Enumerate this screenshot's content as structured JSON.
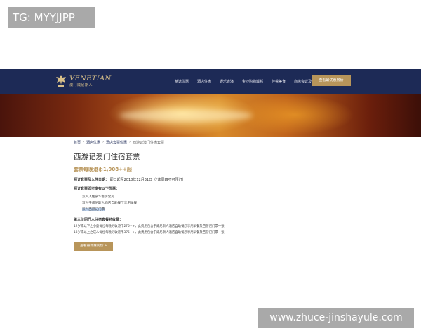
{
  "watermarks": {
    "top": "TG: MYYJJPP",
    "bottom": "www.zhuce-jinshayule.com"
  },
  "brand": {
    "name": "VENETIAN",
    "sub": "澳门威尼斯人",
    "accent": "#b8955a",
    "nav_bg": "#1d2a56"
  },
  "nav": {
    "items": [
      "精选优惠",
      "酒店住宿",
      "娱乐表演",
      "金沙购物城邦",
      "佳肴美食",
      "商务会议及婚宴"
    ],
    "cta": "查看最优惠房价"
  },
  "breadcrumb": [
    "首页",
    "酒店优惠",
    "酒店套票优惠",
    "西游记澳门住宿套票"
  ],
  "page": {
    "title": "西游记澳门住宿套票",
    "price": "套票每晚港币1,908++起",
    "dates_label": "预订套票及入住日期：",
    "dates_value": "即日起至2018年12月31日（*逢周四不可预订）",
    "intro": "预订套票即可享有以下优惠：",
    "bullets": [
      "双人入住豪华客房套房",
      "双人于威尼斯人酒店自助餐厅享用早餐",
      "双人西游记门票"
    ],
    "extra_title": "第三位同行人住宿套餐补收费：",
    "extra_lines": [
      "12岁或以下之小童每位每晚另收港币275++，此费用包含于威尼斯人酒店自助餐厅享用早餐及西游记门票一张",
      "13岁或以上之成人每位每晚另收港币375++，此费用包含于威尼斯人酒店自助餐厅享用早餐及西游记门票一张"
    ],
    "book_button": "查看最优惠房价 »"
  }
}
